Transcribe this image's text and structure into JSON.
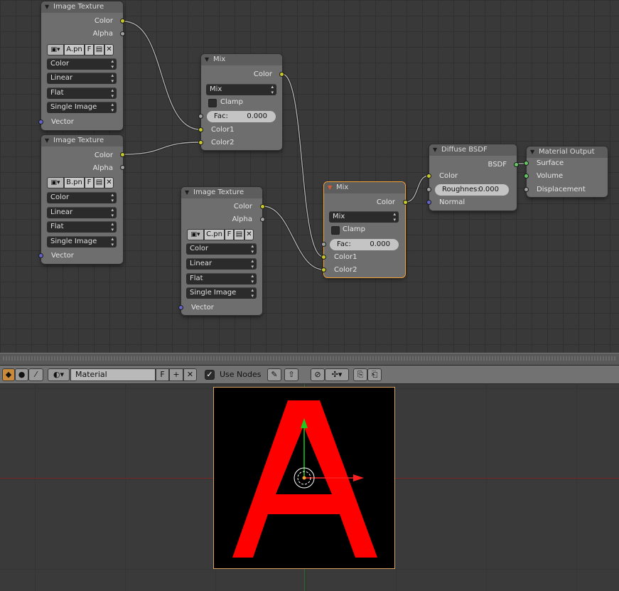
{
  "node_editor": {
    "nodes": {
      "tex_a": {
        "title": "Image Texture",
        "outputs": [
          "Color",
          "Alpha"
        ],
        "image": {
          "type_icon": "image-browse-icon",
          "name": "A.pn",
          "fake_user": "F"
        },
        "color_space": "Color",
        "interpolation": "Linear",
        "projection": "Flat",
        "extension": "Single Image",
        "inputs": [
          "Vector"
        ]
      },
      "tex_b": {
        "title": "Image Texture",
        "outputs": [
          "Color",
          "Alpha"
        ],
        "image": {
          "type_icon": "image-browse-icon",
          "name": "B.pn",
          "fake_user": "F"
        },
        "color_space": "Color",
        "interpolation": "Linear",
        "projection": "Flat",
        "extension": "Single Image",
        "inputs": [
          "Vector"
        ]
      },
      "tex_c": {
        "title": "Image Texture",
        "outputs": [
          "Color",
          "Alpha"
        ],
        "image": {
          "type_icon": "image-browse-icon",
          "name": "C.pn",
          "fake_user": "F"
        },
        "color_space": "Color",
        "interpolation": "Linear",
        "projection": "Flat",
        "extension": "Single Image",
        "inputs": [
          "Vector"
        ]
      },
      "mix_1": {
        "title": "Mix",
        "output": "Color",
        "blend_type": "Mix",
        "clamp_label": "Clamp",
        "clamp": false,
        "fac_label": "Fac:",
        "fac_value": "0.000",
        "inputs": [
          "Color1",
          "Color2"
        ]
      },
      "mix_2": {
        "title": "Mix",
        "output": "Color",
        "blend_type": "Mix",
        "clamp_label": "Clamp",
        "clamp": false,
        "fac_label": "Fac:",
        "fac_value": "0.000",
        "inputs": [
          "Color1",
          "Color2"
        ],
        "active": true
      },
      "diffuse": {
        "title": "Diffuse BSDF",
        "output": "BSDF",
        "color_input": "Color",
        "roughness_label": "Roughnes:",
        "roughness_value": "0.000",
        "normal_input": "Normal"
      },
      "material_output": {
        "title": "Material Output",
        "inputs": [
          "Surface",
          "Volume",
          "Displacement"
        ]
      }
    }
  },
  "header": {
    "material_label": "Material",
    "fake_user": "F",
    "use_nodes_label": "Use Nodes",
    "use_nodes_checked": true,
    "icons": [
      "object-icon",
      "world-icon",
      "brush-icon",
      "material-browse-icon",
      "add-icon",
      "unlink-icon",
      "pin-icon",
      "parent-icon",
      "snap-icon",
      "snap-target-icon",
      "copy-icon",
      "paste-icon"
    ]
  },
  "viewport": {
    "texture_letter": "A",
    "colors": {
      "letter": "#ff0000",
      "background": "#000000",
      "x_axis": "#7a2727",
      "y_axis": "#2a6a2a",
      "selection": "#f2a033"
    }
  }
}
